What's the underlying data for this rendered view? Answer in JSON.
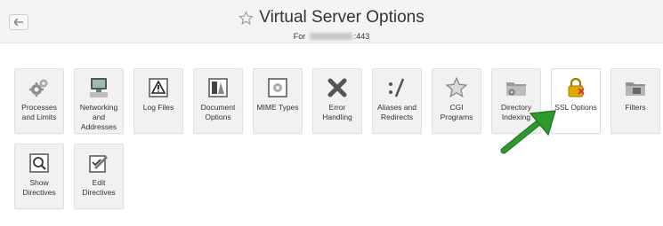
{
  "header": {
    "title": "Virtual Server Options",
    "subtitle_prefix": "For",
    "subtitle_suffix": ":443"
  },
  "tiles": [
    {
      "label": "Processes and Limits",
      "icon": "gears-icon"
    },
    {
      "label": "Networking and Addresses",
      "icon": "computer-icon"
    },
    {
      "label": "Log Files",
      "icon": "warning-icon"
    },
    {
      "label": "Document Options",
      "icon": "document-icon"
    },
    {
      "label": "MIME Types",
      "icon": "mime-icon"
    },
    {
      "label": "Error Handling",
      "icon": "x-icon"
    },
    {
      "label": "Aliases and Redirects",
      "icon": "alias-icon"
    },
    {
      "label": "CGI Programs",
      "icon": "star-icon"
    },
    {
      "label": "Directory Indexing",
      "icon": "folder-icon"
    },
    {
      "label": "SSL Options",
      "icon": "lock-icon"
    },
    {
      "label": "Filters",
      "icon": "filter-folder-icon"
    },
    {
      "label": "Show Directives",
      "icon": "magnifier-icon"
    },
    {
      "label": "Edit Directives",
      "icon": "edit-icon"
    }
  ],
  "colors": {
    "arrow": "#2e9a2e",
    "lock": "#d9a400"
  }
}
